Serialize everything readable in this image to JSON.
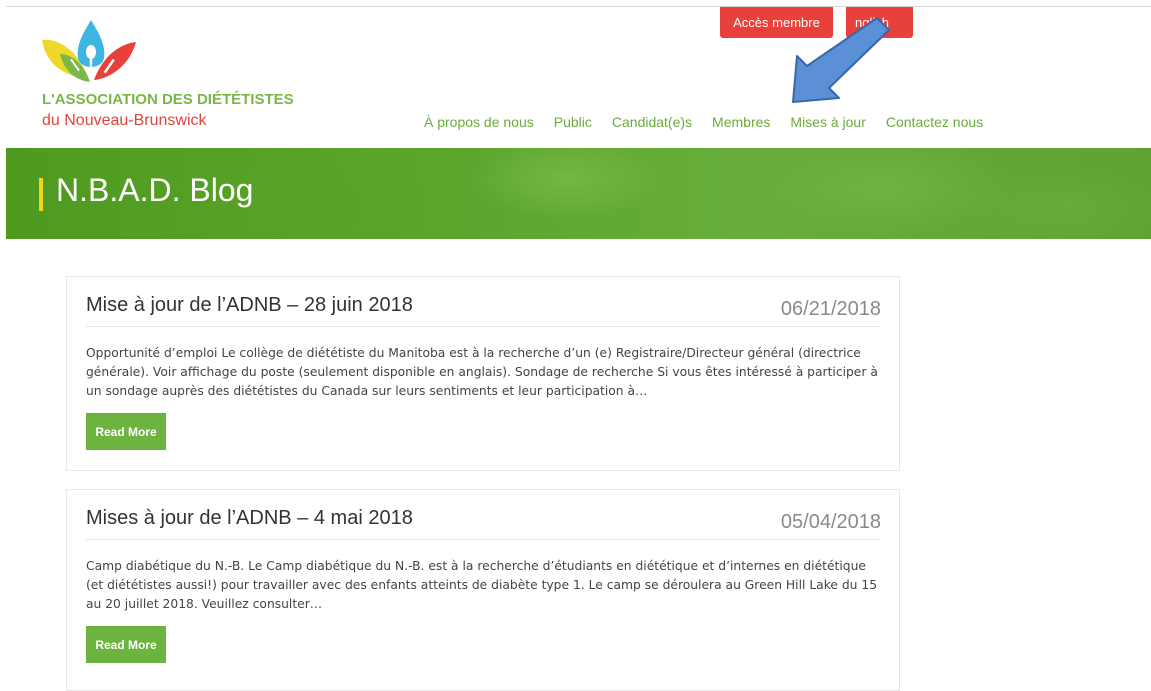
{
  "header": {
    "logo_title": "L'ASSOCIATION DES DIÉTÉTISTES",
    "logo_subtitle": "du Nouveau-Brunswick",
    "member_button": "Accès membre",
    "english_button": "nglish",
    "nav": [
      "À propos de nous",
      "Public",
      "Candidat(e)s",
      "Membres",
      "Mises à jour",
      "Contactez nous"
    ]
  },
  "banner": {
    "title": "N.B.A.D. Blog"
  },
  "posts": [
    {
      "title": "Mise à jour de l’ADNB – 28 juin 2018",
      "date": "06/21/2018",
      "excerpt": "Opportunité d’emploi Le collège de diététiste du Manitoba est à la recherche d’un (e) Registraire/Directeur général (directrice générale).  Voir affichage du poste (seulement disponible en anglais). Sondage de recherche Si vous êtes intéressé à participer à un sondage auprès des diététistes du Canada sur leurs sentiments et leur participation à…",
      "read_more": "Read More"
    },
    {
      "title": "Mises à jour de l’ADNB – 4 mai 2018",
      "date": "05/04/2018",
      "excerpt": "Camp diabétique du N.-B. Le Camp diabétique du N.-B. est à la recherche d’étudiants en diététique et d’internes en diététique (et diététistes aussi!) pour travailler avec des enfants atteints de diabète type 1. Le camp se déroulera au Green Hill Lake du 15 au 20 juillet 2018. Veuillez consulter…",
      "read_more": "Read More"
    }
  ],
  "colors": {
    "brand_green": "#6cab3b",
    "brand_red": "#e8403a",
    "accent_yellow": "#f1d41c",
    "arrow_blue": "#5b8fd6"
  }
}
